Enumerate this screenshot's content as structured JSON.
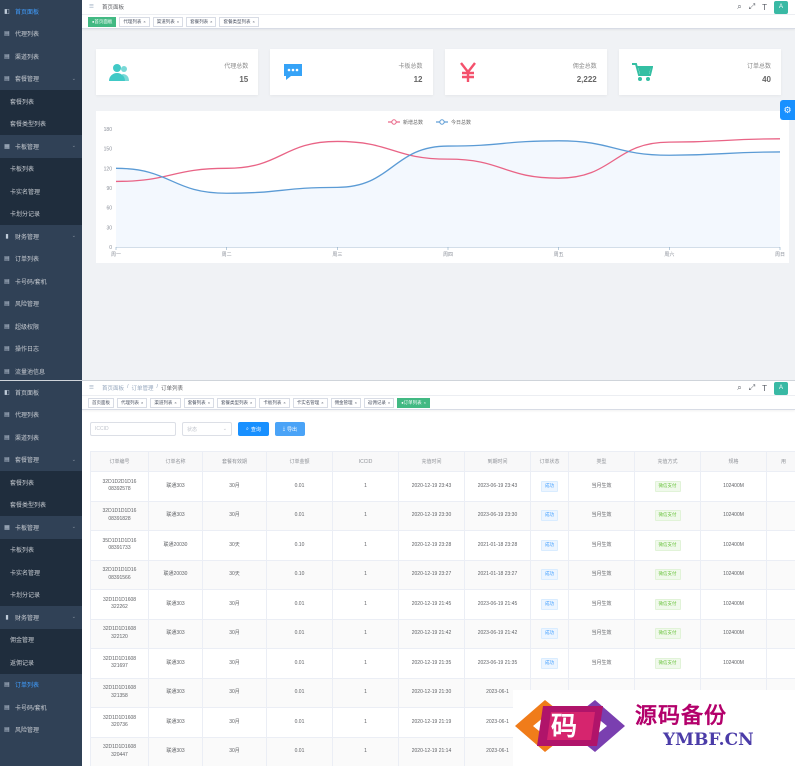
{
  "panelA": {
    "sidebar": [
      {
        "icon": "dashboard-icon",
        "label": "首页面板",
        "type": "item",
        "active": true
      },
      {
        "icon": "doc-icon",
        "label": "代理列表",
        "type": "item"
      },
      {
        "icon": "doc-icon",
        "label": "渠道列表",
        "type": "item"
      },
      {
        "icon": "doc-icon",
        "label": "套餐管理",
        "type": "group"
      },
      {
        "label": "套餐列表",
        "type": "sub"
      },
      {
        "label": "套餐类型列表",
        "type": "sub"
      },
      {
        "icon": "grid-icon",
        "label": "卡板管理",
        "type": "group"
      },
      {
        "label": "卡板列表",
        "type": "sub"
      },
      {
        "label": "卡实名管理",
        "type": "sub"
      },
      {
        "label": "卡划分记录",
        "type": "sub"
      },
      {
        "icon": "chart-icon",
        "label": "财务管理",
        "type": "group"
      },
      {
        "icon": "doc-icon",
        "label": "订单列表",
        "type": "item"
      },
      {
        "icon": "doc-icon",
        "label": "卡号码/套机",
        "type": "item"
      },
      {
        "icon": "doc-icon",
        "label": "风险管理",
        "type": "item"
      },
      {
        "icon": "doc-icon",
        "label": "超级权限",
        "type": "item"
      },
      {
        "icon": "doc-icon",
        "label": "操作日志",
        "type": "item"
      },
      {
        "icon": "doc-icon",
        "label": "流量池信息",
        "type": "item"
      }
    ],
    "breadcrumb": [
      "首页面板"
    ],
    "tags": [
      {
        "label": "首页面板",
        "active": true
      },
      {
        "label": "代理列表"
      },
      {
        "label": "渠道列表"
      },
      {
        "label": "套餐列表"
      },
      {
        "label": "套餐类型列表"
      }
    ],
    "cards": [
      {
        "icon": "user-icon",
        "label": "代理总数",
        "value": "15",
        "color": "#40c9c6"
      },
      {
        "icon": "message-icon",
        "label": "卡板总数",
        "value": "12",
        "color": "#36a3f7"
      },
      {
        "icon": "yen-icon",
        "label": "佣金总数",
        "value": "2,222",
        "color": "#f4516c"
      },
      {
        "icon": "cart-icon",
        "label": "订单总数",
        "value": "40",
        "color": "#34bfa3"
      }
    ],
    "avatar": "A"
  },
  "chart_data": {
    "type": "line",
    "categories": [
      "周一",
      "周二",
      "周三",
      "周四",
      "周五",
      "周六",
      "周日"
    ],
    "ylim": [
      0,
      180
    ],
    "yticks": [
      0,
      30,
      60,
      90,
      120,
      150,
      180
    ],
    "series": [
      {
        "name": "新增总数",
        "values": [
          100,
          120,
          161,
          134,
          105,
          160,
          165
        ],
        "color": "#e96486"
      },
      {
        "name": "今日总数",
        "values": [
          120,
          82,
          91,
          154,
          162,
          140,
          145
        ],
        "color": "#5b9bd5"
      }
    ],
    "legend": "top-center",
    "grid": false
  },
  "panelB": {
    "sidebar": [
      {
        "icon": "dashboard-icon",
        "label": "首页面板",
        "type": "item"
      },
      {
        "icon": "doc-icon",
        "label": "代理列表",
        "type": "item"
      },
      {
        "icon": "doc-icon",
        "label": "渠道列表",
        "type": "item"
      },
      {
        "icon": "doc-icon",
        "label": "套餐管理",
        "type": "group"
      },
      {
        "label": "套餐列表",
        "type": "sub"
      },
      {
        "label": "套餐类型列表",
        "type": "sub"
      },
      {
        "icon": "grid-icon",
        "label": "卡板管理",
        "type": "group"
      },
      {
        "label": "卡板列表",
        "type": "sub"
      },
      {
        "label": "卡实名管理",
        "type": "sub"
      },
      {
        "label": "卡划分记录",
        "type": "sub"
      },
      {
        "icon": "chart-icon",
        "label": "财务管理",
        "type": "group"
      },
      {
        "label": "佣金管理",
        "type": "sub"
      },
      {
        "label": "返佣记录",
        "type": "sub"
      },
      {
        "icon": "doc-icon",
        "label": "订单列表",
        "type": "item",
        "active": true
      },
      {
        "icon": "doc-icon",
        "label": "卡号码/套机",
        "type": "item"
      },
      {
        "icon": "doc-icon",
        "label": "风险管理",
        "type": "item"
      }
    ],
    "breadcrumb": [
      "首页面板",
      "订单管理",
      "订单列表"
    ],
    "tags": [
      {
        "label": "首页面板"
      },
      {
        "label": "代理列表"
      },
      {
        "label": "渠道列表"
      },
      {
        "label": "套餐列表"
      },
      {
        "label": "套餐类型列表"
      },
      {
        "label": "卡板列表"
      },
      {
        "label": "卡实名管理"
      },
      {
        "label": "佣金管理"
      },
      {
        "label": "返佣记录"
      },
      {
        "label": "订单列表",
        "active": true
      }
    ],
    "filters": {
      "iccid_placeholder": "ICCID",
      "status_placeholder": "状态",
      "search": "查询",
      "export": "导出"
    },
    "table": {
      "headers": [
        "订单编号",
        "订单名称",
        "套餐有效期",
        "订单金额",
        "ICCID",
        "充值时间",
        "到期时间",
        "订单状态",
        "类型",
        "充值方式",
        "规格",
        "用"
      ],
      "rows": [
        [
          "32D1D2D1D16\n08392578",
          "联通303",
          "30月",
          "0.01",
          "1",
          "2020-12-19 23:43",
          "2023-06-19 23:43",
          "成功",
          "当月生效",
          "微信支付",
          "102400M",
          ""
        ],
        [
          "32D1D1D1D16\n08391828",
          "联通303",
          "30月",
          "0.01",
          "1",
          "2020-12-19 23:30",
          "2023-06-19 23:30",
          "成功",
          "当月生效",
          "微信支付",
          "102400M",
          ""
        ],
        [
          "35D1D1D1D16\n08391733",
          "联通20030",
          "30天",
          "0.10",
          "1",
          "2020-12-19 23:28",
          "2021-01-18 23:28",
          "成功",
          "当月生效",
          "微信支付",
          "102400M",
          ""
        ],
        [
          "32D1D1D1D16\n08391566",
          "联通20030",
          "30天",
          "0.10",
          "1",
          "2020-12-19 23:27",
          "2021-01-18 23:27",
          "成功",
          "当月生效",
          "微信支付",
          "102400M",
          ""
        ],
        [
          "32D1D1D1608\n322262",
          "联通303",
          "30月",
          "0.01",
          "1",
          "2020-12-19 21:45",
          "2023-06-19 21:45",
          "成功",
          "当月生效",
          "微信支付",
          "102400M",
          ""
        ],
        [
          "32D1D1D1608\n322120",
          "联通303",
          "30月",
          "0.01",
          "1",
          "2020-12-19 21:42",
          "2023-06-19 21:42",
          "成功",
          "当月生效",
          "微信支付",
          "102400M",
          ""
        ],
        [
          "32D1D1D1608\n321697",
          "联通303",
          "30月",
          "0.01",
          "1",
          "2020-12-19 21:35",
          "2023-06-19 21:35",
          "成功",
          "当月生效",
          "微信支付",
          "102400M",
          ""
        ],
        [
          "32D1D1D1608\n321358",
          "联通303",
          "30月",
          "0.01",
          "1",
          "2020-12-19 21:30",
          "2023-06-1",
          "",
          "",
          "",
          "",
          ""
        ],
        [
          "32D1D1D1608\n320736",
          "联通303",
          "30月",
          "0.01",
          "1",
          "2020-12-19 21:19",
          "2023-06-1",
          "",
          "",
          "",
          "",
          ""
        ],
        [
          "32D1D1D1608\n320447",
          "联通303",
          "30月",
          "0.01",
          "1",
          "2020-12-19 21:14",
          "2023-06-1",
          "",
          "",
          "",
          "",
          ""
        ]
      ]
    },
    "avatar": "A"
  },
  "watermark": {
    "title": "源码备份",
    "domain": "YMBF.CN",
    "logo_char": "码"
  }
}
